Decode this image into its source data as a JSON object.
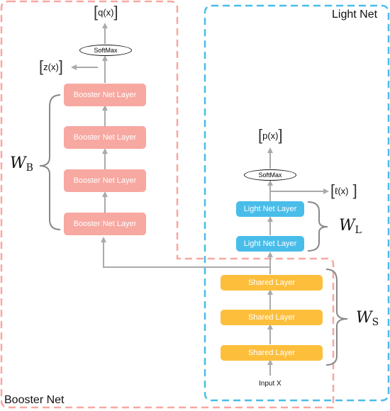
{
  "booster_net": {
    "title": "Booster Net",
    "layers": [
      "Booster Net Layer",
      "Booster Net Layer",
      "Booster Net Layer",
      "Booster Net Layer"
    ],
    "softmax": "SoftMax",
    "output": "q(x)",
    "logits": "z(x)",
    "weight_symbol": "W",
    "weight_sub": "B",
    "color": "#f7a8a1"
  },
  "light_net": {
    "title": "Light Net",
    "layers": [
      "Light Net Layer",
      "Light Net Layer"
    ],
    "softmax": "SoftMax",
    "output": "p(x)",
    "logits": "ℓ(x)",
    "weight_symbol": "W",
    "weight_sub": "L",
    "color": "#49bdea"
  },
  "shared": {
    "layers": [
      "Shared Layer",
      "Shared Layer",
      "Shared Layer"
    ],
    "weight_symbol": "W",
    "weight_sub": "S",
    "color": "#fdbf3b"
  },
  "input": "Input X"
}
